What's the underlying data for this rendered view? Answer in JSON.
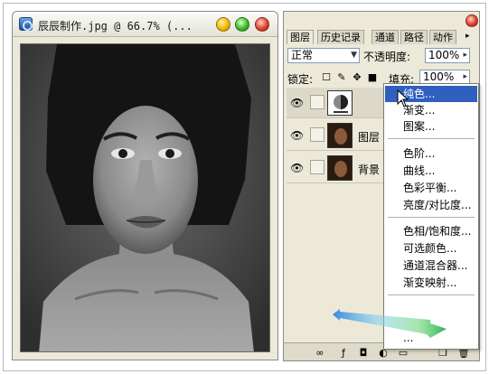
{
  "document": {
    "title": "辰辰制作.jpg @ 66.7% (..."
  },
  "panel": {
    "tabs": [
      "图层",
      "历史记录",
      "通道",
      "路径",
      "动作"
    ],
    "blend_mode": "正常",
    "opacity_label": "不透明度:",
    "opacity_value": "100%",
    "lock_label": "锁定:",
    "fill_label": "填充:",
    "fill_value": "100%",
    "layers": [
      {
        "name": ""
      },
      {
        "name": "图层 1"
      },
      {
        "name": "背景"
      }
    ]
  },
  "menu": {
    "items": [
      "纯色...",
      "渐变...",
      "图案...",
      "色阶...",
      "曲线...",
      "色彩平衡...",
      "亮度/对比度...",
      "色相/饱和度...",
      "可选颜色...",
      "通道混合器...",
      "渐变映射..."
    ],
    "highlighted_index": 0
  },
  "colors": {
    "menu_highlight": "#2f5fbf",
    "window_bg": "#ece9d8"
  }
}
